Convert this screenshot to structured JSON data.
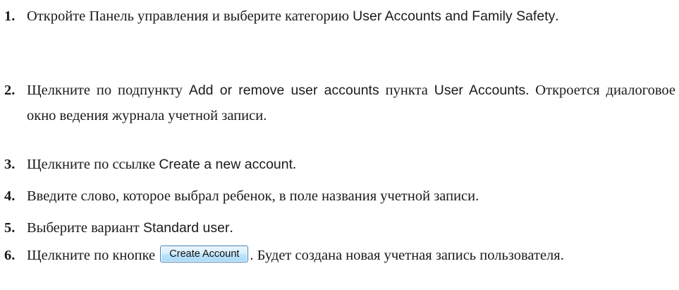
{
  "steps": [
    {
      "number": "1.",
      "parts": [
        {
          "type": "text",
          "value": "Откройте Панель управления и выберите категорию "
        },
        {
          "type": "ui",
          "value": "User Accounts and Family Safety"
        },
        {
          "type": "text",
          "value": "."
        }
      ]
    },
    {
      "number": "2.",
      "parts": [
        {
          "type": "text",
          "value": "Щелкните по подпункту "
        },
        {
          "type": "ui",
          "value": "Add or remove user accounts"
        },
        {
          "type": "text",
          "value": " пункта "
        },
        {
          "type": "ui",
          "value": "User Accounts"
        },
        {
          "type": "text",
          "value": ". Откроется диалоговое окно ведения журнала учетной записи."
        }
      ]
    },
    {
      "number": "3.",
      "parts": [
        {
          "type": "text",
          "value": "Щелкните по ссылке "
        },
        {
          "type": "ui",
          "value": "Create a new account"
        },
        {
          "type": "text",
          "value": "."
        }
      ]
    },
    {
      "number": "4.",
      "parts": [
        {
          "type": "text",
          "value": "Введите слово, которое выбрал ребенок, в поле названия учетной записи."
        }
      ]
    },
    {
      "number": "5.",
      "parts": [
        {
          "type": "text",
          "value": "Выберите вариант "
        },
        {
          "type": "ui",
          "value": "Standard user"
        },
        {
          "type": "text",
          "value": "."
        }
      ]
    },
    {
      "number": "6.",
      "parts": [
        {
          "type": "text",
          "value": "Щелкните по кнопке "
        },
        {
          "type": "button",
          "value": "Create Account"
        },
        {
          "type": "text",
          "value": ". Будет создана новая учетная запись пользователя."
        }
      ]
    }
  ]
}
